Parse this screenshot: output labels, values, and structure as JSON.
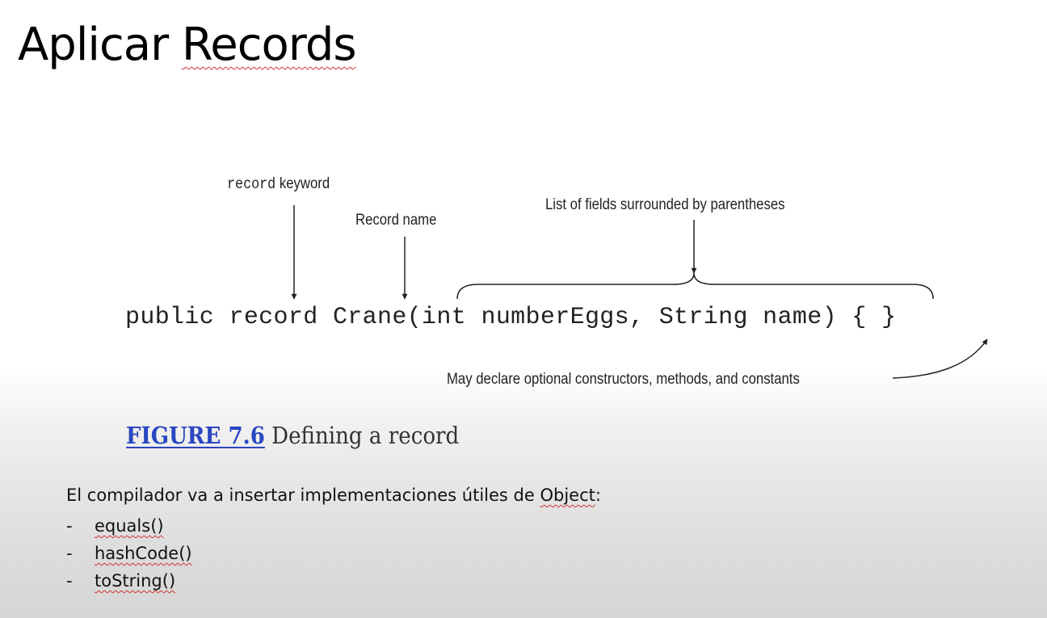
{
  "slide": {
    "title_prefix": "Aplicar ",
    "title_word": "Records"
  },
  "figure": {
    "annotations": {
      "record_keyword_code": "record",
      "record_keyword_text": " keyword",
      "record_name": "Record name",
      "fields_list": "List of fields surrounded by parentheses",
      "optional_members": "May declare optional constructors, methods, and constants"
    },
    "code": "public record Crane(int numberEggs, String name) { }",
    "caption_label": "FIGURE 7.6",
    "caption_text": " Defining a record"
  },
  "notes": {
    "intro_before": "El compilador va a insertar implementaciones útiles de ",
    "intro_word": "Object",
    "intro_after": ":",
    "items": [
      {
        "dash": "-",
        "label": "equals()"
      },
      {
        "dash": "-",
        "label": "hashCode()"
      },
      {
        "dash": "-",
        "label": "toString()"
      }
    ]
  }
}
